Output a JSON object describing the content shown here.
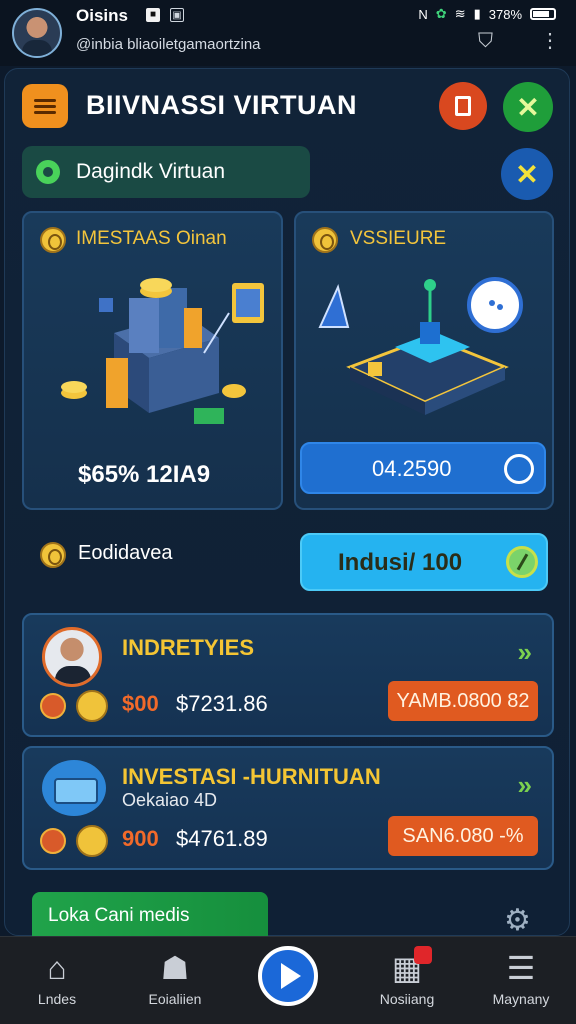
{
  "topbar": {
    "name": "Oisins",
    "handle": "@inbia bliaoiletgamaortzina",
    "status_battery": "378%"
  },
  "header": {
    "title": "BIIVNASSI VIRTUAN"
  },
  "chip": {
    "label": "Dagindk Virtuan"
  },
  "cards": [
    {
      "title": "IMESTAAS Oinan",
      "value": "$65% 12IA9"
    },
    {
      "title": "VSSIEURE",
      "value": "04.2590"
    }
  ],
  "row2": {
    "label": "Eodidavea",
    "button_value": "Indusi/ 100"
  },
  "list": [
    {
      "title": "INDRETYIES",
      "subtitle": "",
      "amount1": "$00",
      "amount2": "$7231.86",
      "tag": "YAMB.0800 82"
    },
    {
      "title": "INVESTASI -HURNITUAN",
      "subtitle": "Oekaiao 4D",
      "amount1": "900",
      "amount2": "$4761.89",
      "tag": "SAN6.080 -%"
    }
  ],
  "bottom_chip": {
    "label": "Loka Cani medis"
  },
  "nav": [
    {
      "label": "Lndes",
      "icon": "home-icon"
    },
    {
      "label": "Eoialiien",
      "icon": "ghost-icon"
    },
    {
      "label": "",
      "icon": "play-icon"
    },
    {
      "label": "Nosiiang",
      "icon": "grid-icon"
    },
    {
      "label": "Maynany",
      "icon": "menu-icon"
    }
  ],
  "colors": {
    "background": "#0d1a2b",
    "accent_gold": "#f3c53c",
    "accent_orange": "#e05a20",
    "accent_cyan": "#25b3f0",
    "accent_green": "#1f9e3a"
  }
}
